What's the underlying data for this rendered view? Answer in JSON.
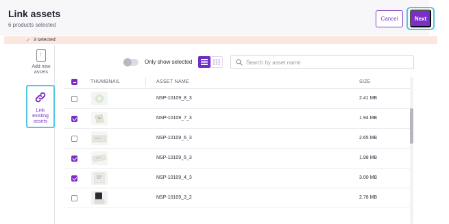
{
  "header": {
    "title": "Link assets",
    "subtitle": "6 products selected",
    "cancel_label": "Cancel",
    "next_label": "Next"
  },
  "banner": {
    "text": "3 selected"
  },
  "sidebar": {
    "items": [
      {
        "label": "Add new assets",
        "icon": "upload-file-icon",
        "active": false
      },
      {
        "label": "Link existing assets",
        "icon": "link-icon",
        "active": true
      }
    ]
  },
  "toolbar": {
    "toggle_label": "Only show selected",
    "toggle_on": false,
    "view_mode": "list",
    "search_placeholder": "Search by asset name",
    "search_value": ""
  },
  "table": {
    "columns": [
      "THUMBNAIL",
      "ASSET NAME",
      "SIZE"
    ],
    "header_checkbox": "partial",
    "rows": [
      {
        "name": "NSP-10109_8_3",
        "size": "2.41 MB",
        "checked": false,
        "thumb": "gel-pad"
      },
      {
        "name": "NSP-10109_7_3",
        "size": "1.94 MB",
        "checked": true,
        "thumb": "paper-bag"
      },
      {
        "name": "NSP-10109_6_3",
        "size": "2.65 MB",
        "checked": false,
        "thumb": "label-strip"
      },
      {
        "name": "NSP-10109_5_3",
        "size": "1.98 MB",
        "checked": true,
        "thumb": "strip-angled"
      },
      {
        "name": "NSP-10109_4_3",
        "size": "3.00 MB",
        "checked": true,
        "thumb": "labeled-box"
      },
      {
        "name": "NSP-10109_3_2",
        "size": "2.76 MB",
        "checked": false,
        "thumb": "dark-device"
      }
    ]
  },
  "colors": {
    "accent": "#7b2fc9",
    "highlight_ring": "#4fc7e3",
    "banner_bg": "#fbe7df"
  }
}
